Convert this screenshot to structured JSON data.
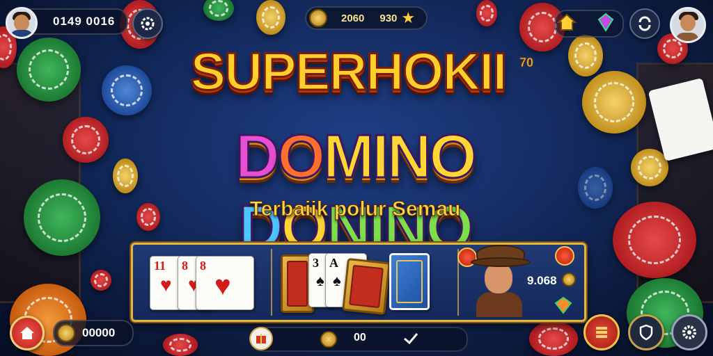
{
  "top_bar": {
    "player_balance": "0149 0016",
    "center_value_1": "2060",
    "center_value_2": "930"
  },
  "title": {
    "line1": "SUPERHOKII",
    "line1_superscript": "70",
    "line2_parts": [
      "D",
      "O",
      "MINO ",
      "D",
      "O",
      "NINO"
    ],
    "tagline": "Terbaiik polur Semau"
  },
  "game_panel": {
    "hand_cards": [
      {
        "rank": "11",
        "suit": "♥"
      },
      {
        "rank": "8",
        "suit": "♥"
      },
      {
        "rank": "8",
        "suit": "♥"
      }
    ],
    "deck_cards": [
      {
        "rank": "3",
        "suit": "♠"
      },
      {
        "rank": "A",
        "suit": "♠"
      }
    ],
    "hero_value": "9.068"
  },
  "bottom_bar": {
    "coins_value": "00000",
    "bar_value": "00"
  },
  "colors": {
    "panel_border": "#e0b445",
    "accent_gold": "#ffd743",
    "home_button": "#d9342b"
  },
  "icons": {
    "top_left": "avatar",
    "top_left_button": "settings-icon",
    "top_right": [
      "home-icon",
      "gem-icon",
      "refresh-icon",
      "avatar"
    ],
    "bottom_left": [
      "home-icon",
      "coin-icon"
    ],
    "bottom_right": [
      "stack-icon",
      "shield-icon",
      "gear-icon"
    ]
  }
}
